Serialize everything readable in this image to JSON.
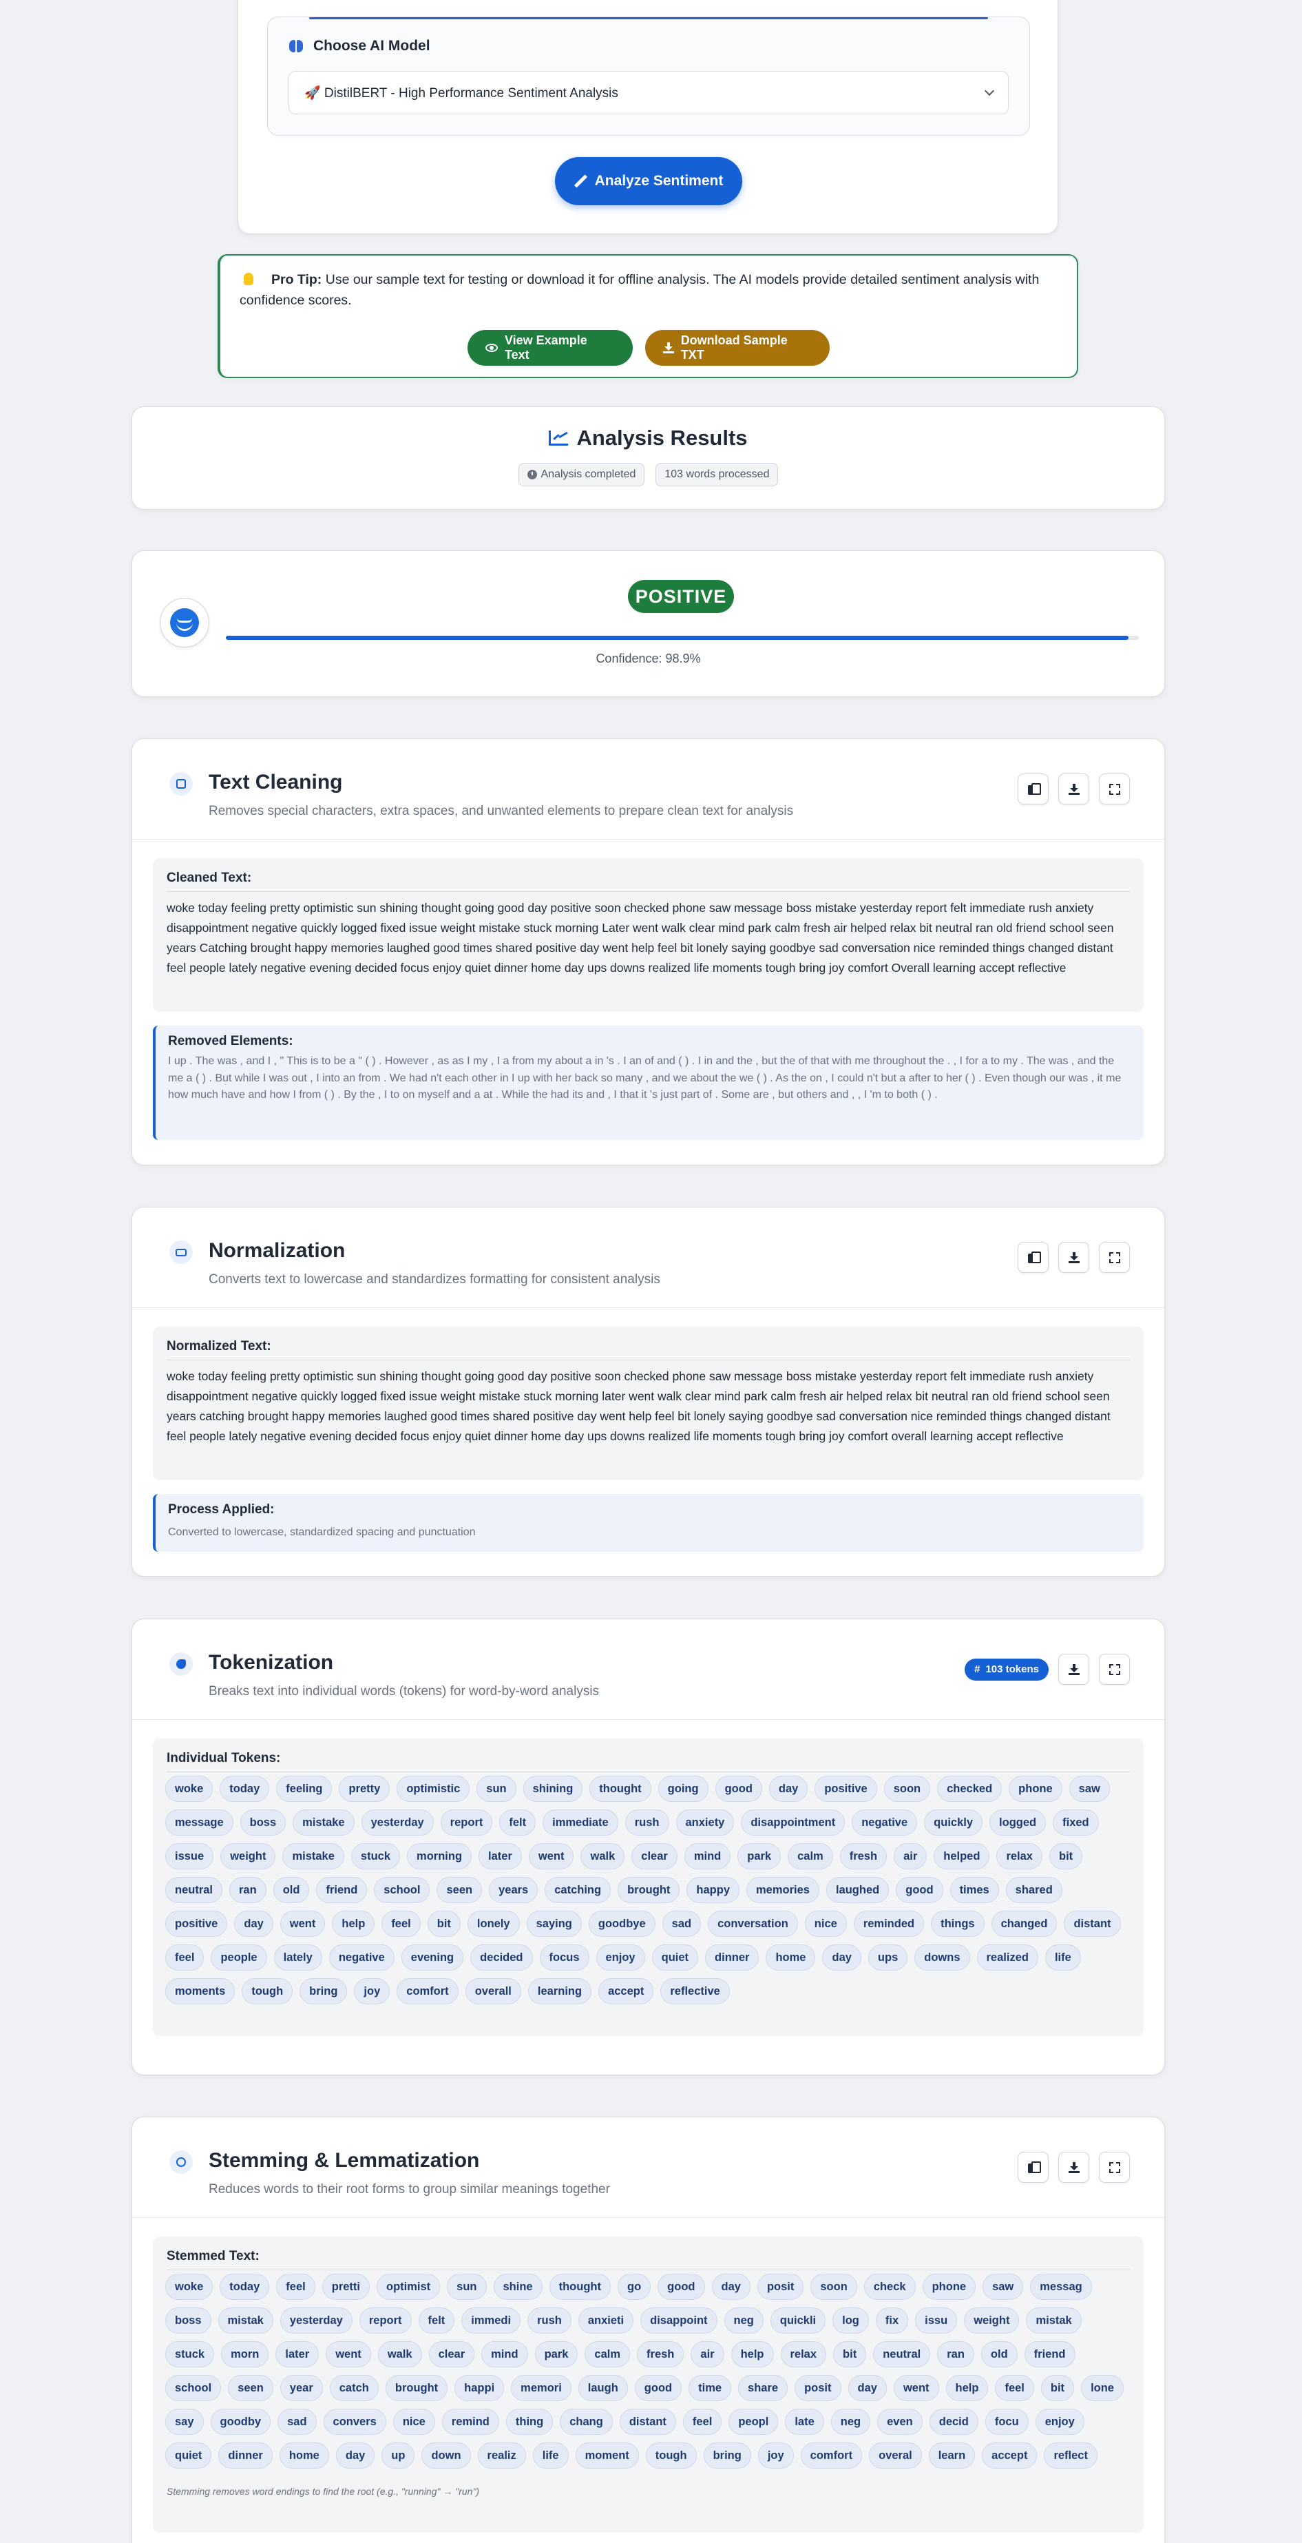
{
  "model": {
    "label": "Choose AI Model",
    "selected": "🚀 DistilBERT - High Performance Sentiment Analysis",
    "analyze_label": "Analyze Sentiment"
  },
  "tip": {
    "bold": "Pro Tip:",
    "text": " Use our sample text for testing or download it for offline analysis. The AI models provide detailed sentiment analysis with confidence scores.",
    "view_label": "View Example Text",
    "download_label": "Download Sample TXT"
  },
  "results": {
    "title": "Analysis Results",
    "status": "Analysis completed",
    "words": "103 words processed"
  },
  "sentiment": {
    "label": "POSITIVE",
    "confidence_text": "Confidence: 98.9%",
    "confidence": 98.9
  },
  "cleaning": {
    "title": "Text Cleaning",
    "subtitle": "Removes special characters, extra spaces, and unwanted elements to prepare clean text for analysis",
    "panel_label": "Cleaned Text:",
    "text": "woke today feeling pretty optimistic sun shining thought going good day positive soon checked phone saw message boss mistake yesterday report felt immediate rush anxiety disappointment negative quickly logged fixed issue weight mistake stuck morning Later went walk clear mind park calm fresh air helped relax bit neutral ran old friend school seen years Catching brought happy memories laughed good times shared positive day went help feel bit lonely saying goodbye sad conversation nice reminded things changed distant feel people lately negative evening decided focus enjoy quiet dinner home day ups downs realized life moments tough bring joy comfort Overall learning accept reflective",
    "removed_label": "Removed Elements:",
    "removed": "I up . The was , and I , \" This is to be a \" ( ) . However , as as I my , I a from my about a in 's . I an of and ( ) . I in and the , but the of that with me throughout the . , I for a to my . The was , and the me a ( ) . But while I was out , I into an from . We had n't each other in I up with her back so many , and we about the we ( ) . As the on , I could n't but a after to her ( ) . Even though our was , it me how much have and how I from ( ) . By the , I to on myself and a at . While the had its and , I that it 's just part of . Some are , but others and , , I 'm to both ( ) ."
  },
  "normalization": {
    "title": "Normalization",
    "subtitle": "Converts text to lowercase and standardizes formatting for consistent analysis",
    "panel_label": "Normalized Text:",
    "text": "woke today feeling pretty optimistic sun shining thought going good day positive soon checked phone saw message boss mistake yesterday report felt immediate rush anxiety disappointment negative quickly logged fixed issue weight mistake stuck morning later went walk clear mind park calm fresh air helped relax bit neutral ran old friend school seen years catching brought happy memories laughed good times shared positive day went help feel bit lonely saying goodbye sad conversation nice reminded things changed distant feel people lately negative evening decided focus enjoy quiet dinner home day ups downs realized life moments tough bring joy comfort overall learning accept reflective",
    "process_label": "Process Applied:",
    "process_text": "Converted to lowercase, standardized spacing and punctuation"
  },
  "tokenization": {
    "title": "Tokenization",
    "subtitle": "Breaks text into individual words (tokens) for word-by-word analysis",
    "badge": "103 tokens",
    "panel_label": "Individual Tokens:",
    "tokens": [
      "woke",
      "today",
      "feeling",
      "pretty",
      "optimistic",
      "sun",
      "shining",
      "thought",
      "going",
      "good",
      "day",
      "positive",
      "soon",
      "checked",
      "phone",
      "saw",
      "message",
      "boss",
      "mistake",
      "yesterday",
      "report",
      "felt",
      "immediate",
      "rush",
      "anxiety",
      "disappointment",
      "negative",
      "quickly",
      "logged",
      "fixed",
      "issue",
      "weight",
      "mistake",
      "stuck",
      "morning",
      "later",
      "went",
      "walk",
      "clear",
      "mind",
      "park",
      "calm",
      "fresh",
      "air",
      "helped",
      "relax",
      "bit",
      "neutral",
      "ran",
      "old",
      "friend",
      "school",
      "seen",
      "years",
      "catching",
      "brought",
      "happy",
      "memories",
      "laughed",
      "good",
      "times",
      "shared",
      "positive",
      "day",
      "went",
      "help",
      "feel",
      "bit",
      "lonely",
      "saying",
      "goodbye",
      "sad",
      "conversation",
      "nice",
      "reminded",
      "things",
      "changed",
      "distant",
      "feel",
      "people",
      "lately",
      "negative",
      "evening",
      "decided",
      "focus",
      "enjoy",
      "quiet",
      "dinner",
      "home",
      "day",
      "ups",
      "downs",
      "realized",
      "life",
      "moments",
      "tough",
      "bring",
      "joy",
      "comfort",
      "overall",
      "learning",
      "accept",
      "reflective"
    ]
  },
  "stemming": {
    "title": "Stemming & Lemmatization",
    "subtitle": "Reduces words to their root forms to group similar meanings together",
    "panel_label": "Stemmed Text:",
    "stems": [
      "woke",
      "today",
      "feel",
      "pretti",
      "optimist",
      "sun",
      "shine",
      "thought",
      "go",
      "good",
      "day",
      "posit",
      "soon",
      "check",
      "phone",
      "saw",
      "messag",
      "boss",
      "mistak",
      "yesterday",
      "report",
      "felt",
      "immedi",
      "rush",
      "anxieti",
      "disappoint",
      "neg",
      "quickli",
      "log",
      "fix",
      "issu",
      "weight",
      "mistak",
      "stuck",
      "morn",
      "later",
      "went",
      "walk",
      "clear",
      "mind",
      "park",
      "calm",
      "fresh",
      "air",
      "help",
      "relax",
      "bit",
      "neutral",
      "ran",
      "old",
      "friend",
      "school",
      "seen",
      "year",
      "catch",
      "brought",
      "happi",
      "memori",
      "laugh",
      "good",
      "time",
      "share",
      "posit",
      "day",
      "went",
      "help",
      "feel",
      "bit",
      "lone",
      "say",
      "goodby",
      "sad",
      "convers",
      "nice",
      "remind",
      "thing",
      "chang",
      "distant",
      "feel",
      "peopl",
      "late",
      "neg",
      "even",
      "decid",
      "focu",
      "enjoy",
      "quiet",
      "dinner",
      "home",
      "day",
      "up",
      "down",
      "realiz",
      "life",
      "moment",
      "tough",
      "bring",
      "joy",
      "comfort",
      "overal",
      "learn",
      "accept",
      "reflect"
    ],
    "note": "Stemming removes word endings to find the root (e.g., \"running\" → \"run\")"
  }
}
